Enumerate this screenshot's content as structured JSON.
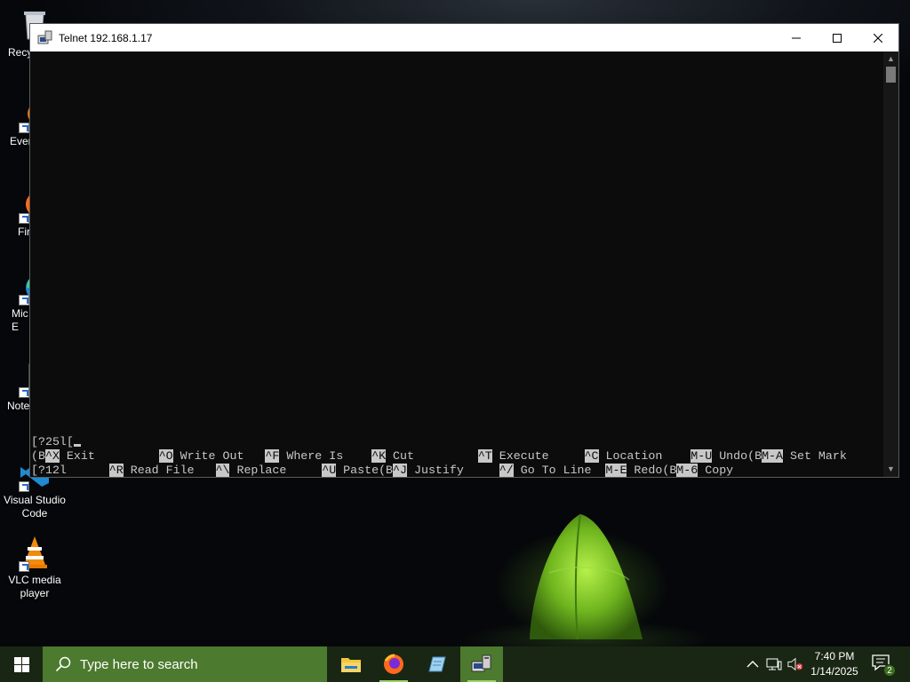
{
  "desktop": {
    "icons": [
      {
        "name": "recycle-bin",
        "label": "Recy"
      },
      {
        "name": "everything",
        "label": "Ever"
      },
      {
        "name": "firefox",
        "label": "Fir"
      },
      {
        "name": "microsoft-edge",
        "label": "Mic\nE"
      },
      {
        "name": "notepad-plus-plus",
        "label": "Note"
      },
      {
        "name": "visual-studio-code",
        "label": "Visual Studio\nCode"
      },
      {
        "name": "vlc-media-player",
        "label": "VLC media\nplayer"
      }
    ]
  },
  "window": {
    "title": "Telnet 192.168.1.17",
    "minimize_icon": "minimize-icon",
    "maximize_icon": "maximize-icon",
    "close_icon": "close-icon"
  },
  "console": {
    "prompt_line": "[?25l[",
    "row1_prefix": "(B",
    "row2_prefix": "[?12l",
    "shortcuts_row1": [
      {
        "key": "^X",
        "label": " Exit      "
      },
      {
        "key": "^O",
        "label": " Write Out "
      },
      {
        "key": "^F",
        "label": " Where Is  "
      },
      {
        "key": "^K",
        "label": " Cut       "
      },
      {
        "key": "^T",
        "label": " Execute   "
      },
      {
        "key": "^C",
        "label": " Location  "
      },
      {
        "key": "M-U",
        "label": " Undo(B"
      },
      {
        "key": "M-A",
        "label": " Set Mark"
      }
    ],
    "shortcuts_row2": [
      {
        "key": "^R",
        "label": " Read File "
      },
      {
        "key": "^\\",
        "label": " Replace   "
      },
      {
        "key": "^U",
        "label": " Paste(B"
      },
      {
        "key": "^J",
        "label": " Justify   "
      },
      {
        "key": "^/",
        "label": " Go To Line "
      },
      {
        "key": "M-E",
        "label": " Redo(B"
      },
      {
        "key": "M-6",
        "label": " Copy"
      }
    ]
  },
  "taskbar": {
    "search_placeholder": "Type here to search",
    "apps": [
      "file-explorer",
      "firefox",
      "notepad",
      "telnet"
    ],
    "clock_time": "7:40 PM",
    "clock_date": "1/14/2025",
    "notification_count": "2"
  },
  "colors": {
    "taskbar_bg": "#1a2614",
    "taskbar_accent": "#4c7a2e",
    "console_bg": "#0c0c0c",
    "console_fg": "#c8c8c8"
  }
}
